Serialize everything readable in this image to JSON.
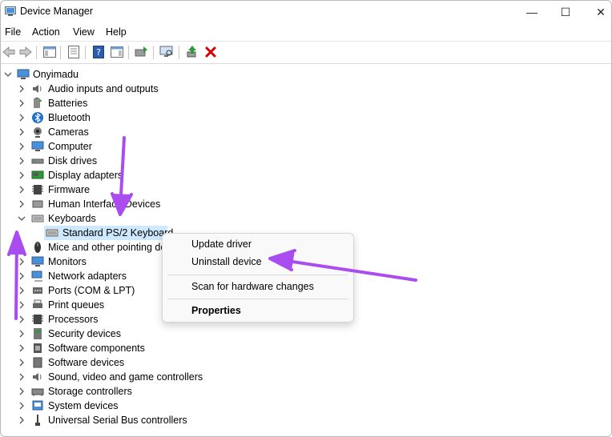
{
  "window": {
    "title": "Device Manager",
    "icon": "device-manager-icon"
  },
  "window_buttons": {
    "minimize": "—",
    "maximize": "☐",
    "close": "✕"
  },
  "menu": [
    "File",
    "Action",
    "View",
    "Help"
  ],
  "toolbar": {
    "icons": [
      "back-icon",
      "forward-icon",
      "show-hide-console-tree-icon",
      "properties-icon",
      "help-icon",
      "action-pane-icon",
      "update-driver-icon",
      "scan-hardware-icon",
      "enable-device-icon",
      "uninstall-device-icon"
    ]
  },
  "tree": {
    "root": "Onyimadu",
    "items": [
      {
        "label": "Audio inputs and outputs",
        "icon": "speaker-icon"
      },
      {
        "label": "Batteries",
        "icon": "battery-icon"
      },
      {
        "label": "Bluetooth",
        "icon": "bluetooth-icon"
      },
      {
        "label": "Cameras",
        "icon": "camera-icon"
      },
      {
        "label": "Computer",
        "icon": "monitor-icon"
      },
      {
        "label": "Disk drives",
        "icon": "disk-drive-icon"
      },
      {
        "label": "Display adapters",
        "icon": "display-adapter-icon"
      },
      {
        "label": "Firmware",
        "icon": "chip-icon"
      },
      {
        "label": "Human Interface Devices",
        "icon": "hid-icon"
      },
      {
        "label": "Keyboards",
        "icon": "keyboard-icon",
        "expanded": true
      },
      {
        "label": "Standard PS/2 Keyboard",
        "icon": "keyboard-icon",
        "child": true,
        "selected": true
      },
      {
        "label": "Mice and other pointing devices",
        "icon": "mouse-icon"
      },
      {
        "label": "Monitors",
        "icon": "monitor-icon"
      },
      {
        "label": "Network adapters",
        "icon": "network-icon"
      },
      {
        "label": "Ports (COM & LPT)",
        "icon": "port-icon"
      },
      {
        "label": "Print queues",
        "icon": "printer-icon"
      },
      {
        "label": "Processors",
        "icon": "chip-icon"
      },
      {
        "label": "Security devices",
        "icon": "security-device-icon"
      },
      {
        "label": "Software components",
        "icon": "software-component-icon"
      },
      {
        "label": "Software devices",
        "icon": "software-device-icon"
      },
      {
        "label": "Sound, video and game controllers",
        "icon": "speaker-icon"
      },
      {
        "label": "Storage controllers",
        "icon": "storage-controller-icon"
      },
      {
        "label": "System devices",
        "icon": "system-device-icon"
      },
      {
        "label": "Universal Serial Bus controllers",
        "icon": "usb-icon"
      }
    ]
  },
  "context_menu": {
    "items": [
      "Update driver",
      "Uninstall device",
      "Scan for hardware changes",
      "Properties"
    ]
  },
  "colors": {
    "annotation_arrow": "#a94df0",
    "selection": "#cde8ff",
    "uninstall_red": "#d40000"
  }
}
